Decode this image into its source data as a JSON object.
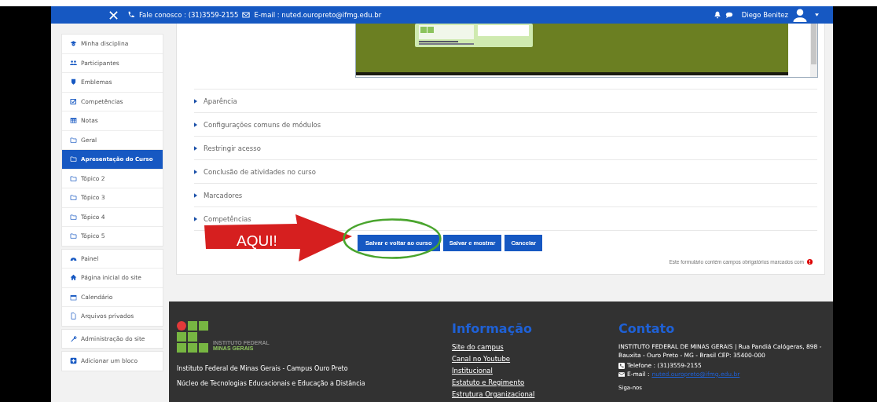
{
  "header": {
    "contact_label": "Fale conosco : (31)3559-2155",
    "email_label": "E-mail : nuted.ouropreto@ifmg.edu.br",
    "user_name": "Diego Benitez"
  },
  "sidebar": {
    "groups": [
      {
        "items": [
          {
            "kind": "graduation",
            "label": "Minha disciplina",
            "selected": false
          },
          {
            "kind": "users",
            "label": "Participantes",
            "selected": false
          },
          {
            "kind": "shield",
            "label": "Emblemas",
            "selected": false
          },
          {
            "kind": "checkbox",
            "label": "Competências",
            "selected": false
          },
          {
            "kind": "table",
            "label": "Notas",
            "selected": false
          },
          {
            "kind": "folder",
            "label": "Geral",
            "selected": false
          },
          {
            "kind": "folder",
            "label": "Apresentação do Curso",
            "selected": true
          },
          {
            "kind": "folder",
            "label": "Tópico 2",
            "selected": false
          },
          {
            "kind": "folder",
            "label": "Tópico 3",
            "selected": false
          },
          {
            "kind": "folder",
            "label": "Tópico 4",
            "selected": false
          },
          {
            "kind": "folder",
            "label": "Tópico 5",
            "selected": false
          }
        ]
      },
      {
        "items": [
          {
            "kind": "dashboard",
            "label": "Painel",
            "selected": false
          },
          {
            "kind": "home",
            "label": "Página inicial do site",
            "selected": false
          },
          {
            "kind": "calendar",
            "label": "Calendário",
            "selected": false
          },
          {
            "kind": "file",
            "label": "Arquivos privados",
            "selected": false
          }
        ]
      },
      {
        "items": [
          {
            "kind": "wrench",
            "label": "Administração do site",
            "selected": false
          }
        ]
      },
      {
        "items": [
          {
            "kind": "plus",
            "label": "Adicionar um bloco",
            "selected": false
          }
        ]
      }
    ]
  },
  "form": {
    "preview": {
      "kind": "picture"
    },
    "sections": [
      {
        "label": "Aparência",
        "expanded": false
      },
      {
        "label": "Configurações comuns de módulos",
        "expanded": false
      },
      {
        "label": "Restringir acesso",
        "expanded": false
      },
      {
        "label": "Conclusão de atividades no curso",
        "expanded": false
      },
      {
        "label": "Marcadores",
        "expanded": false
      },
      {
        "label": "Competências",
        "expanded": false
      }
    ],
    "buttons": [
      "Salvar e voltar ao curso",
      "Salvar e mostrar",
      "Cancelar"
    ],
    "required_note": "Este formulário contém campos obrigatórios marcados com",
    "annotation": {
      "text": "AQUI!"
    }
  },
  "footer": {
    "logo": {
      "line_1": "INSTITUTO FEDERAL",
      "line_2": "MINAS GERAIS"
    },
    "about": [
      "Instituto Federal de Minas Gerais - Campus Ouro Preto",
      "Núcleo de Tecnologias Educacionais e Educação a Distância"
    ],
    "info": {
      "title": "Informação",
      "links": [
        "Site do campus",
        "Canal no Youtube",
        "Institucional",
        "Estatuto e Regimento",
        "Estrutura Organizacional"
      ]
    },
    "contact": {
      "title": "Contato",
      "address": "INSTITUTO FEDERAL DE MINAS GERAIS | Rua Pandiá Calógeras, 898 - Bauxita - Ouro Preto - MG - Brasil CEP: 35400-000",
      "phone": "Telefone : (31)3559-2155",
      "email_label": "E-mail :",
      "email": "nuted.ouropreto@ifmg.edu.br",
      "social": "Siga-nos"
    }
  }
}
